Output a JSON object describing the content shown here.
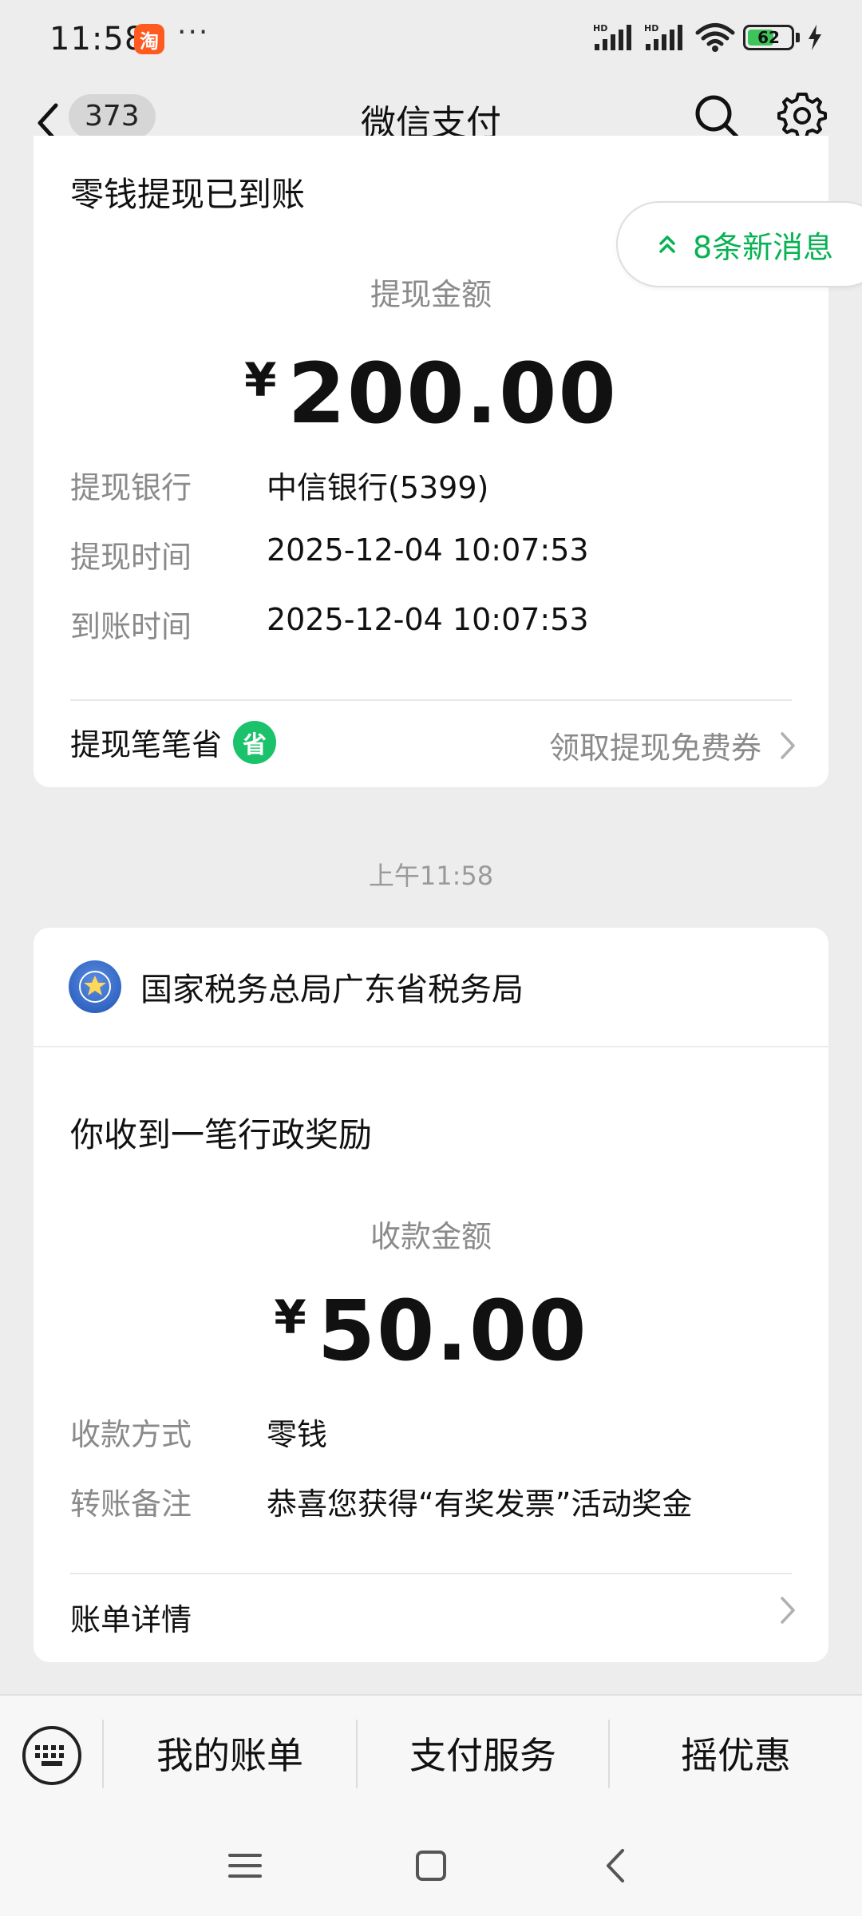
{
  "status_bar": {
    "time": "11:58",
    "taobao_glyph": "淘",
    "more": "···",
    "battery": "62",
    "battery_fraction": 0.62,
    "hd_label_1": "HD",
    "hd_label_2": "HD"
  },
  "nav": {
    "unread_count": "373",
    "title": "微信支付",
    "icons": [
      "back-icon",
      "search-icon",
      "gear-icon"
    ]
  },
  "new_messages": "8条新消息",
  "card1": {
    "heading": "零钱提现已到账",
    "amount_label": "提现金额",
    "currency": "¥",
    "amount": "200.00",
    "rows": [
      {
        "key": "提现银行",
        "value": "中信银行(5399)"
      },
      {
        "key": "提现时间",
        "value": "2025-12-04 10:07:53"
      },
      {
        "key": "到账时间",
        "value": "2025-12-04 10:07:53"
      }
    ],
    "footer_left": "提现笔笔省",
    "footer_badge": "省",
    "footer_right": "领取提现免费券"
  },
  "timestamp": "上午11:58",
  "card2": {
    "sender": "国家税务总局广东省税务局",
    "heading": "你收到一笔行政奖励",
    "amount_label": "收款金额",
    "currency": "¥",
    "amount": "50.00",
    "rows": [
      {
        "key": "收款方式",
        "value": "零钱"
      },
      {
        "key": "转账备注",
        "value": "恭喜您获得“有奖发票”活动奖金"
      }
    ],
    "footer_left": "账单详情"
  },
  "bottom_menu": {
    "items": [
      "我的账单",
      "支付服务",
      "摇优惠"
    ]
  },
  "colors": {
    "accent_green": "#07b253",
    "badge_green": "#19c26b",
    "background": "#ededed"
  }
}
